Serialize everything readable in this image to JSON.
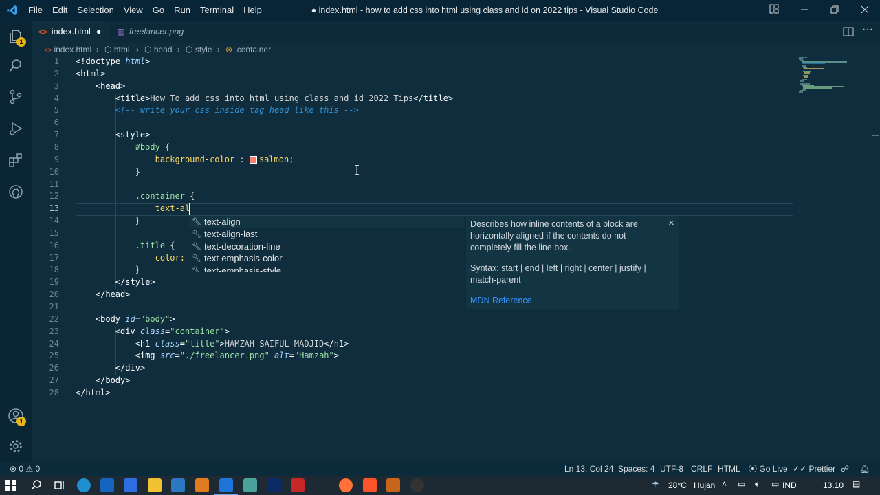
{
  "window": {
    "title": "● index.html - how to add css into html using class and id on 2022 tips - Visual Studio Code",
    "menu": [
      "File",
      "Edit",
      "Selection",
      "View",
      "Go",
      "Run",
      "Terminal",
      "Help"
    ]
  },
  "tabs": [
    {
      "label": "index.html",
      "modified_marker": "●",
      "active": true
    },
    {
      "label": "freelancer.png",
      "active": false
    }
  ],
  "breadcrumb": [
    "index.html",
    "html",
    "head",
    "style",
    ".container"
  ],
  "activity_badges": {
    "explorer": "1",
    "accounts": "1"
  },
  "code_lines": [
    {
      "n": "1",
      "segs": [
        [
          "t-tag",
          "<!doctype "
        ],
        [
          "t-attr",
          "html"
        ],
        [
          "t-tag",
          ">"
        ]
      ]
    },
    {
      "n": "2",
      "segs": [
        [
          "t-tag",
          "<html>"
        ]
      ]
    },
    {
      "n": "3",
      "segs": [
        [
          "",
          "    "
        ],
        [
          "t-tag",
          "<head>"
        ]
      ]
    },
    {
      "n": "4",
      "segs": [
        [
          "",
          "        "
        ],
        [
          "t-tag",
          "<title>"
        ],
        [
          "t-id",
          "How To add css into html using class and id 2022 Tips"
        ],
        [
          "t-tag",
          "</title>"
        ]
      ]
    },
    {
      "n": "5",
      "segs": [
        [
          "",
          "        "
        ],
        [
          "t-cm",
          "<!-- write your css inside tag head like this -->"
        ]
      ]
    },
    {
      "n": "6",
      "segs": [
        [
          "",
          ""
        ]
      ]
    },
    {
      "n": "7",
      "segs": [
        [
          "",
          "        "
        ],
        [
          "t-tag",
          "<style>"
        ]
      ]
    },
    {
      "n": "8",
      "segs": [
        [
          "",
          "            "
        ],
        [
          "t-sel",
          "#body"
        ],
        [
          "t-id",
          " {"
        ]
      ]
    },
    {
      "n": "9",
      "segs": [
        [
          "",
          "                "
        ],
        [
          "t-prop",
          "background-color"
        ],
        [
          "t-id",
          " : "
        ],
        [
          "swatch",
          ""
        ],
        [
          "t-val",
          "salmon"
        ],
        [
          "t-id",
          ";"
        ]
      ]
    },
    {
      "n": "10",
      "segs": [
        [
          "",
          "            "
        ],
        [
          "t-id",
          "}"
        ]
      ]
    },
    {
      "n": "11",
      "segs": [
        [
          "",
          ""
        ]
      ]
    },
    {
      "n": "12",
      "segs": [
        [
          "",
          "            "
        ],
        [
          "t-sel",
          ".container"
        ],
        [
          "t-id",
          " {"
        ]
      ]
    },
    {
      "n": "13",
      "segs": [
        [
          "",
          "                "
        ],
        [
          "t-prop",
          "text-al"
        ]
      ]
    },
    {
      "n": "14",
      "segs": [
        [
          "",
          "            "
        ],
        [
          "t-id",
          "}"
        ]
      ]
    },
    {
      "n": "15",
      "segs": [
        [
          "",
          ""
        ]
      ]
    },
    {
      "n": "16",
      "segs": [
        [
          "",
          "            "
        ],
        [
          "t-sel",
          ".title"
        ],
        [
          "t-id",
          " {"
        ]
      ]
    },
    {
      "n": "17",
      "segs": [
        [
          "",
          "                "
        ],
        [
          "t-prop",
          "color:"
        ]
      ]
    },
    {
      "n": "18",
      "segs": [
        [
          "",
          "            "
        ],
        [
          "t-id",
          "}"
        ]
      ]
    },
    {
      "n": "19",
      "segs": [
        [
          "",
          "        "
        ],
        [
          "t-tag",
          "</style>"
        ]
      ]
    },
    {
      "n": "20",
      "segs": [
        [
          "",
          "    "
        ],
        [
          "t-tag",
          "</head>"
        ]
      ]
    },
    {
      "n": "21",
      "segs": [
        [
          "",
          ""
        ]
      ]
    },
    {
      "n": "22",
      "segs": [
        [
          "",
          "    "
        ],
        [
          "t-tag",
          "<body "
        ],
        [
          "t-attr",
          "id"
        ],
        [
          "t-tag",
          "="
        ],
        [
          "t-str",
          "\"body\""
        ],
        [
          "t-tag",
          ">"
        ]
      ]
    },
    {
      "n": "23",
      "segs": [
        [
          "",
          "        "
        ],
        [
          "t-tag",
          "<div "
        ],
        [
          "t-attr",
          "class"
        ],
        [
          "t-tag",
          "="
        ],
        [
          "t-str",
          "\"container\""
        ],
        [
          "t-tag",
          ">"
        ]
      ]
    },
    {
      "n": "24",
      "segs": [
        [
          "",
          "            "
        ],
        [
          "t-tag",
          "<h1 "
        ],
        [
          "t-attr",
          "class"
        ],
        [
          "t-tag",
          "="
        ],
        [
          "t-str",
          "\"title\""
        ],
        [
          "t-tag",
          ">"
        ],
        [
          "t-id",
          "HAMZAH SAIFUL MADJID"
        ],
        [
          "t-tag",
          "</h1>"
        ]
      ]
    },
    {
      "n": "25",
      "segs": [
        [
          "",
          "            "
        ],
        [
          "t-tag",
          "<img "
        ],
        [
          "t-attr",
          "src"
        ],
        [
          "t-tag",
          "="
        ],
        [
          "t-str",
          "\"./freelancer.png\""
        ],
        [
          "t-id",
          " "
        ],
        [
          "t-attr",
          "alt"
        ],
        [
          "t-tag",
          "="
        ],
        [
          "t-str",
          "\"Hamzah\""
        ],
        [
          "t-tag",
          ">"
        ]
      ]
    },
    {
      "n": "26",
      "segs": [
        [
          "",
          "        "
        ],
        [
          "t-tag",
          "</div>"
        ]
      ]
    },
    {
      "n": "27",
      "segs": [
        [
          "",
          "    "
        ],
        [
          "t-tag",
          "</body>"
        ]
      ]
    },
    {
      "n": "28",
      "segs": [
        [
          "t-tag",
          "</html>"
        ]
      ]
    }
  ],
  "suggestions": [
    "text-align",
    "text-align-last",
    "text-decoration-line",
    "text-emphasis-color",
    "text-emphasis-style"
  ],
  "doc": {
    "description": "Describes how inline contents of a block are horizontally aligned if the contents do not completely fill the line box.",
    "syntax": "Syntax: start | end | left | right | center | justify | match-parent",
    "link": "MDN Reference",
    "close": "×"
  },
  "status": {
    "problems": "0",
    "warnings": "0",
    "position": "Ln 13, Col 24",
    "spaces": "Spaces: 4",
    "encoding": "UTF-8",
    "eol": "CRLF",
    "language": "HTML",
    "golive": "Go Live",
    "prettier": "Prettier"
  },
  "taskbar": {
    "temp": "28°C",
    "weather": "Hujan",
    "lang": "IND",
    "time": "13.10"
  },
  "colors": {
    "accent": "#1e74d9",
    "swatch": "#fa8072",
    "badge": "#e7b416"
  }
}
